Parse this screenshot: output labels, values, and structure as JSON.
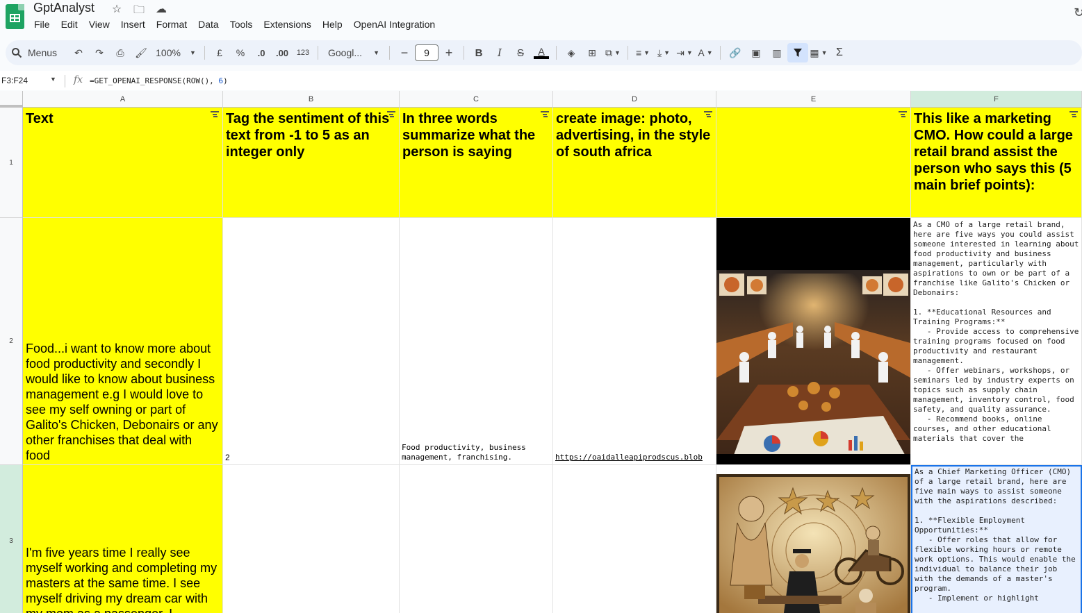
{
  "app": {
    "title": "GptAnalyst",
    "menus": [
      "File",
      "Edit",
      "View",
      "Insert",
      "Format",
      "Data",
      "Tools",
      "Extensions",
      "Help",
      "OpenAI Integration"
    ]
  },
  "toolbar": {
    "search_label": "Menus",
    "zoom": "100%",
    "currency": "£",
    "percent": "%",
    "dec_decrease": ".0",
    "dec_increase": ".00",
    "number_format": "123",
    "font": "Googl...",
    "font_size": "9",
    "bold": "B",
    "italic": "I",
    "text_color_glyph": "A",
    "sum": "Σ"
  },
  "formula_bar": {
    "name_box": "F3:F24",
    "formula_prefix": "=GET_OPENAI_RESPONSE(ROW(), ",
    "formula_arg": "6",
    "formula_suffix": ")"
  },
  "columns": [
    "A",
    "B",
    "C",
    "D",
    "E",
    "F"
  ],
  "rows": [
    "1",
    "2",
    "3"
  ],
  "headers": {
    "A": "Text",
    "B": "Tag the sentiment of this text from -1 to 5 as an integer only",
    "C": "In three words summarize what the person is saying",
    "D": "create image: photo, advertising, in the style of south africa",
    "E": "",
    "F": "This like a marketing CMO. How could a large retail brand assist the person who says this (5 main brief points):"
  },
  "row2": {
    "text": "Food...i want to know more about food productivity and secondly I would like to know about business management e.g I would love to see my self owning or part of Galito's Chicken, Debonairs or any other franchises that deal with food",
    "sentiment": "2",
    "summary": "Food productivity, business management, franchising.",
    "image_url": "https://oaidalleapiprodscus.blob",
    "cmo": "As a CMO of a large retail brand, here are five ways you could assist someone interested in learning about food productivity and business management, particularly with aspirations to own or be part of a franchise like Galito's Chicken or Debonairs:\n\n1. **Educational Resources and Training Programs:**\n   - Provide access to comprehensive training programs focused on food productivity and restaurant management.\n   - Offer webinars, workshops, or seminars led by industry experts on topics such as supply chain management, inventory control, food safety, and quality assurance.\n   - Recommend books, online courses, and other educational materials that cover the"
  },
  "row3": {
    "text": "I'm five years time I really see myself working and completing my masters at the same time. I see myself driving my dream car with my mom as a passenger. I",
    "cmo": "As a Chief Marketing Officer (CMO) of a large retail brand, here are five main ways to assist someone with the aspirations described:\n\n1. **Flexible Employment Opportunities:**\n   - Offer roles that allow for flexible working hours or remote work options. This would enable the individual to balance their job with the demands of a master's program.\n   - Implement or highlight"
  },
  "colors": {
    "header_fill": "#ffff00",
    "selection_border": "#1a73e8",
    "selection_fill": "#e8f0fe",
    "sheets_green": "#1ea362"
  }
}
